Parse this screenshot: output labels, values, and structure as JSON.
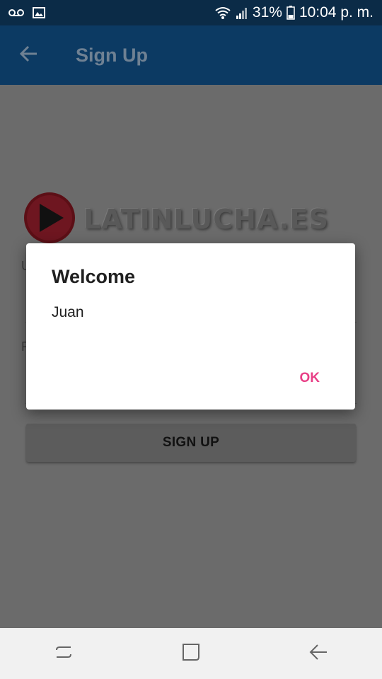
{
  "status_bar": {
    "battery": "31%",
    "time": "10:04 p. m.",
    "icons": [
      "voicemail-icon",
      "image-icon",
      "wifi-icon",
      "signal-icon",
      "battery-icon"
    ]
  },
  "app_bar": {
    "title": "Sign Up",
    "back_icon": "arrow-back-icon"
  },
  "form": {
    "logo_text": "LATINLUCHA.ES",
    "username_label_visible": "U",
    "password_label_visible": "P",
    "signup_button": "SIGN UP"
  },
  "dialog": {
    "title": "Welcome",
    "message": "Juan",
    "ok_button": "OK"
  },
  "nav_bar": {
    "icons": [
      "recent-apps-icon",
      "home-icon",
      "back-nav-icon"
    ]
  },
  "colors": {
    "status_bar": "#0b2b47",
    "app_bar": "#0c3a63",
    "scrim": "#6b6b6b",
    "accent": "#e83f86",
    "logo_red": "#c8102e"
  }
}
